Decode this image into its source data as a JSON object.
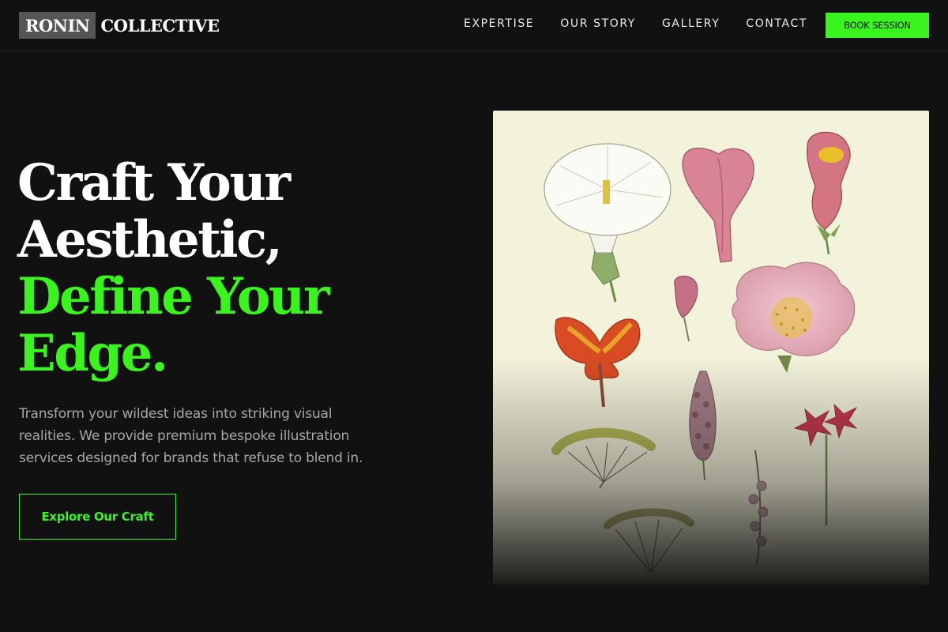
{
  "brand": {
    "box_text": "RONIN",
    "text": "COLLECTIVE"
  },
  "nav": {
    "links": [
      "EXPERTISE",
      "OUR STORY",
      "GALLERY",
      "CONTACT"
    ],
    "cta_label": "BOOK SESSION"
  },
  "hero": {
    "title_line1": "Craft Your",
    "title_line2": "Aesthetic,",
    "title_line3": "Define Your",
    "title_line4": "Edge.",
    "description": "Transform your wildest ideas into striking visual realities. We provide premium bespoke illustration services designed for brands that refuse to blend in.",
    "button_label": "Explore Our Craft"
  },
  "colors": {
    "background": "#111111",
    "accent": "#39f51d",
    "muted_text": "#a7a7ab"
  }
}
